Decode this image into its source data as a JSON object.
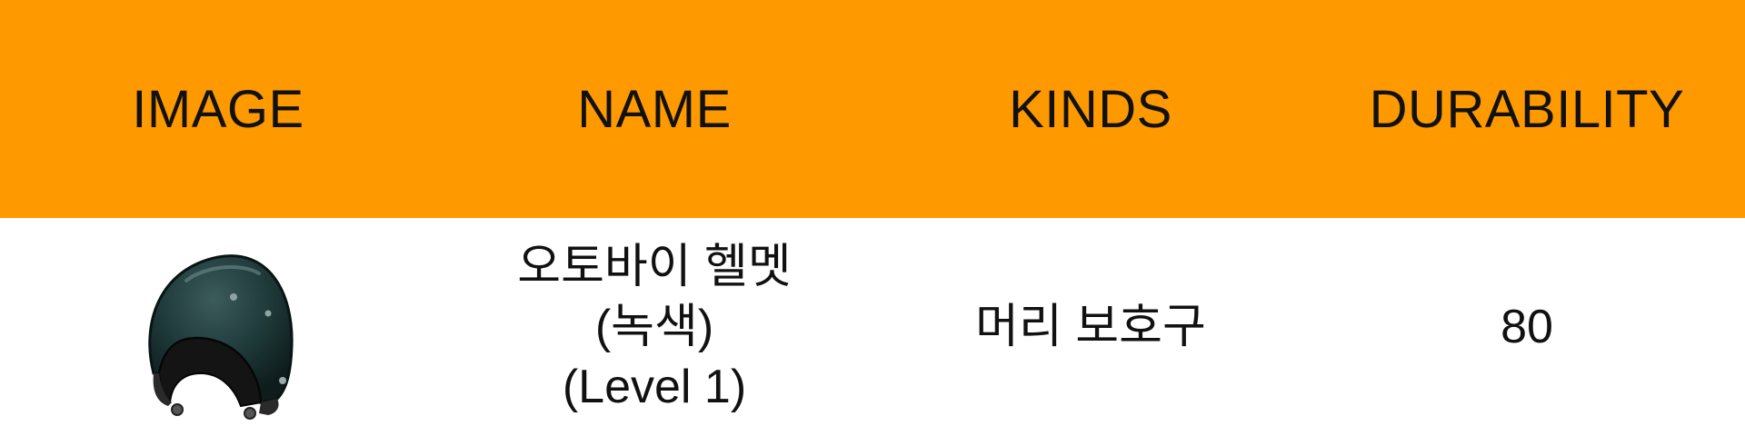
{
  "table": {
    "headers": [
      "IMAGE",
      "NAME",
      "KINDS",
      "DURABILITY"
    ],
    "rows": [
      {
        "image_icon": "helmet-icon",
        "name_lines": [
          "오토바이 헬멧",
          "(녹색)",
          "(Level 1)"
        ],
        "kind": "머리 보호구",
        "durability": "80"
      }
    ]
  },
  "colors": {
    "header_bg": "#ff9900",
    "row_bg": "#ffffff",
    "text": "#111111",
    "helmet": "#1f3a3a"
  }
}
